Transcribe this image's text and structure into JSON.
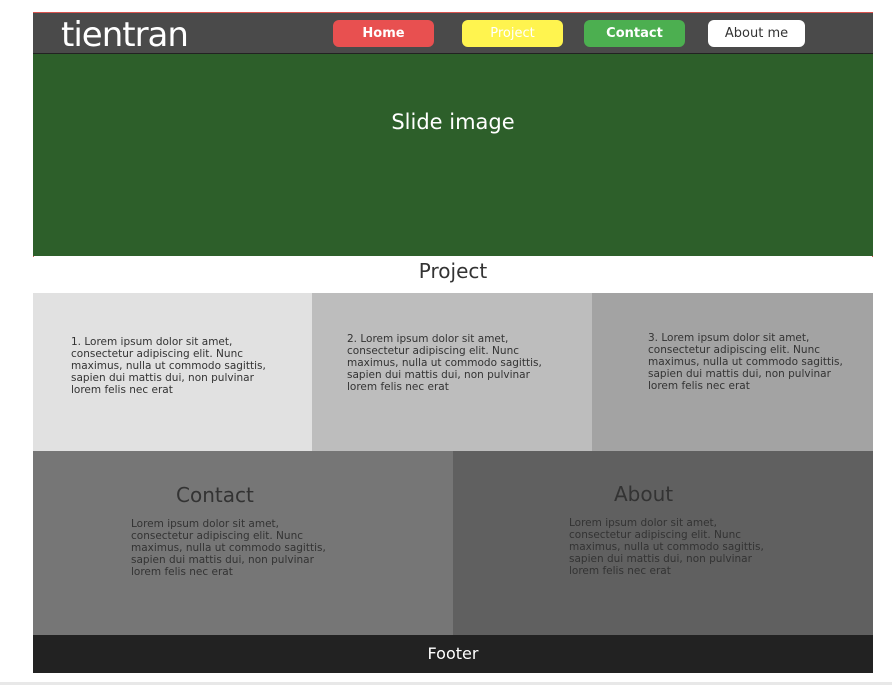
{
  "header": {
    "logo": "tientran",
    "nav": {
      "home": "Home",
      "project": "Project",
      "contact": "Contact",
      "about": "About me"
    }
  },
  "slide": {
    "label": "Slide image"
  },
  "project": {
    "title": "Project",
    "items": [
      "1. Lorem ipsum dolor sit amet, consectetur adipiscing elit. Nunc maximus, nulla ut commodo sagittis, sapien dui mattis dui, non pulvinar lorem felis nec erat",
      "2. Lorem ipsum dolor sit amet, consectetur adipiscing elit. Nunc maximus, nulla ut commodo sagittis, sapien dui mattis dui, non pulvinar lorem felis nec erat",
      "3. Lorem ipsum dolor sit amet, consectetur adipiscing elit. Nunc maximus, nulla ut commodo sagittis, sapien dui mattis dui, non pulvinar lorem felis nec erat"
    ]
  },
  "contact": {
    "title": "Contact",
    "text": "Lorem ipsum dolor sit amet, consectetur adipiscing elit. Nunc maximus, nulla ut commodo sagittis, sapien dui mattis dui, non pulvinar lorem felis nec erat"
  },
  "about": {
    "title": "About",
    "text": "Lorem ipsum dolor sit amet, consectetur adipiscing elit. Nunc maximus, nulla ut commodo sagittis, sapien dui mattis dui, non pulvinar lorem felis nec erat"
  },
  "footer": {
    "label": "Footer"
  },
  "colors": {
    "header_bg": "#4a4a4a",
    "home_btn": "#e85050",
    "project_btn": "#fff44f",
    "contact_btn": "#4caf50",
    "about_btn": "#ffffff",
    "slide_bg": "#2d5f2a",
    "footer_bg": "#222222"
  }
}
